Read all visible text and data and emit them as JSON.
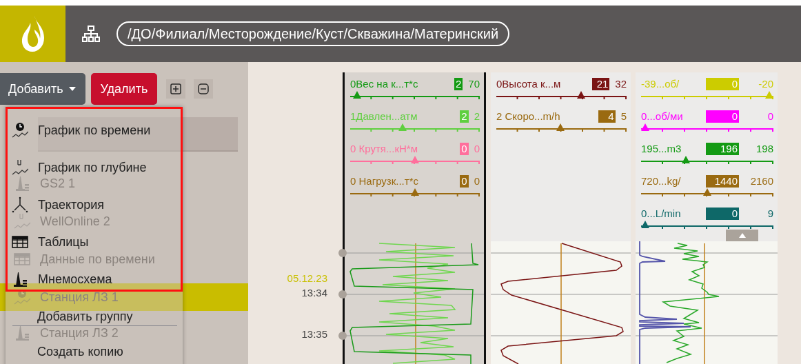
{
  "header": {
    "breadcrumb": "/ДО/Филиал/Месторождение/Куст/Скважина/Материнский"
  },
  "toolbar": {
    "add_button": "Добавить",
    "delete_button": "Удалить"
  },
  "tree": [
    {
      "label": "GS2 1",
      "kind": "mnemo",
      "selected": false
    },
    {
      "label": "WellOnline 2",
      "kind": "depth",
      "selected": false
    },
    {
      "label": "Данные по времени",
      "kind": "table",
      "selected": false
    },
    {
      "label": "Станция ЛЗ 1",
      "kind": "time",
      "selected": true
    },
    {
      "label": "Станция ЛЗ 2",
      "kind": "mnemo",
      "selected": false
    }
  ],
  "menu": {
    "items": [
      {
        "label": "График по времени",
        "kind": "time"
      },
      {
        "label": "График по глубине",
        "kind": "depth"
      },
      {
        "label": "Траектория",
        "kind": "trajectory"
      },
      {
        "label": "Таблицы",
        "kind": "table"
      },
      {
        "label": "Мнемосхема",
        "kind": "mnemo"
      }
    ],
    "actions": [
      "Добавить группу",
      "Создать копию"
    ]
  },
  "time_axis": {
    "date": "05.12.23",
    "times": [
      "13:34",
      "13:35"
    ]
  },
  "tracks": [
    {
      "selected": true,
      "params": [
        {
          "label": "0Вес на к...т*с",
          "value": "2",
          "max": "70",
          "level": 0.02,
          "color": "#139a13"
        },
        {
          "label": "1Давлен...атм",
          "value": "2",
          "max": "2",
          "level": 0.4,
          "color": "#5fcf3f"
        },
        {
          "label": "0 Крутя...кН*м",
          "value": "0",
          "max": "0",
          "level": 0.5,
          "color": "#ff6f9c"
        },
        {
          "label": "0 Нагрузк...т*с",
          "value": "0",
          "max": "0",
          "level": 0.5,
          "color": "#9a6a10"
        }
      ]
    },
    {
      "selected": false,
      "params": [
        {
          "label": "0Высота к...м",
          "value": "21",
          "max": "32",
          "level": 0.66,
          "color": "#7a1414"
        },
        {
          "label": "2 Скоро...m/h",
          "value": "4",
          "max": "5",
          "level": 0.49,
          "color": "#9a6a10"
        }
      ]
    },
    {
      "selected": false,
      "params": [
        {
          "label": "-39...об/",
          "value": "0",
          "max": "-20",
          "level": 1,
          "color": "#cccc00"
        },
        {
          "label": "0...об/ми",
          "value": "0",
          "max": "0",
          "level": 0,
          "color": "#ff00ff"
        },
        {
          "label": "195...m3",
          "value": "196",
          "max": "198",
          "level": 0.33,
          "color": "#149a14"
        },
        {
          "label": "720...kg/",
          "value": "1440",
          "max": "2160",
          "level": 0.5,
          "color": "#9a6a10"
        },
        {
          "label": "0...L/min",
          "value": "0",
          "max": "9",
          "level": 0,
          "color": "#0e6868"
        }
      ]
    }
  ]
}
